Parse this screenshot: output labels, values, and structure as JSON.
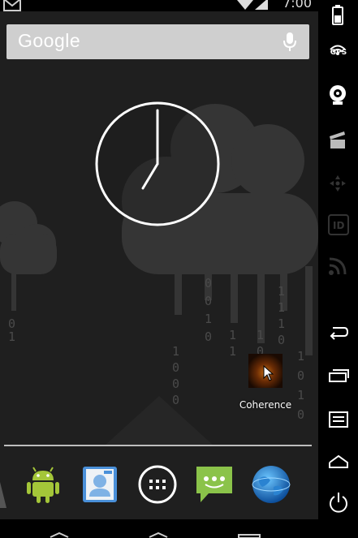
{
  "status_bar": {
    "time": "7:00",
    "icons": [
      "gmail-icon",
      "wifi-icon",
      "signal-icon"
    ]
  },
  "search_bar": {
    "logo_text": "Google",
    "icons": [
      "mic-icon"
    ]
  },
  "clock": {
    "type": "analog",
    "hour": 7,
    "minute": 0
  },
  "apps": {
    "coherence_label": "Coherence"
  },
  "dock": {
    "icons": [
      "android-icon",
      "contacts-icon",
      "app-drawer-icon",
      "messaging-icon",
      "browser-globe-icon"
    ]
  },
  "side_toolbar": {
    "gps_label": "GPS",
    "buttons": [
      "battery-icon",
      "gps-icon",
      "camera-icon",
      "clapperboard-icon",
      "dpad-icon",
      "id-icon",
      "rss-icon",
      "back-icon",
      "recent-apps-icon",
      "menu-icon",
      "home-icon",
      "power-icon"
    ]
  },
  "colors": {
    "background": "#1f1f1f",
    "search_bar": "#cfcfcf",
    "android_green": "#a4c639",
    "messaging_green": "#8bc34a"
  }
}
